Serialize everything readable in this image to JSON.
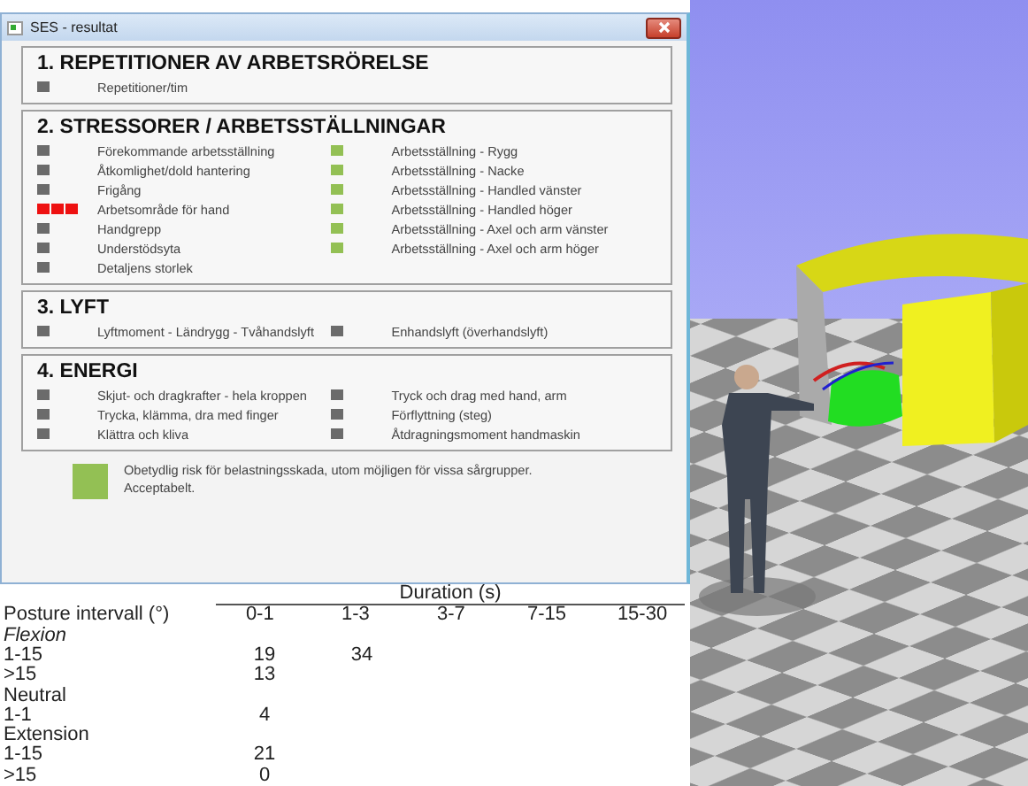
{
  "window": {
    "title": "SES - resultat"
  },
  "sections": [
    {
      "heading": "1. REPETITIONER AV ARBETSRÖRELSE",
      "rows": [
        {
          "left": {
            "label": "Repetitioner/tim",
            "color": "#6b6b6b",
            "kind": "single"
          }
        }
      ]
    },
    {
      "heading": "2. STRESSORER / ARBETSSTÄLLNINGAR",
      "rows": [
        {
          "left": {
            "label": "Förekommande arbetsställning",
            "color": "#6b6b6b",
            "kind": "single"
          },
          "right": {
            "label": "Arbetsställning - Rygg",
            "color": "#93c054",
            "kind": "single"
          }
        },
        {
          "left": {
            "label": "Åtkomlighet/dold hantering",
            "color": "#6b6b6b",
            "kind": "single"
          },
          "right": {
            "label": "Arbetsställning - Nacke",
            "color": "#93c054",
            "kind": "single"
          }
        },
        {
          "left": {
            "label": "Frigång",
            "color": "#6b6b6b",
            "kind": "single"
          },
          "right": {
            "label": "Arbetsställning - Handled vänster",
            "color": "#93c054",
            "kind": "single"
          }
        },
        {
          "left": {
            "label": "Arbetsområde för hand",
            "color": "#ee1111",
            "kind": "triple"
          },
          "right": {
            "label": "Arbetsställning - Handled höger",
            "color": "#93c054",
            "kind": "single"
          }
        },
        {
          "left": {
            "label": "Handgrepp",
            "color": "#6b6b6b",
            "kind": "single"
          },
          "right": {
            "label": "Arbetsställning - Axel och arm vänster",
            "color": "#93c054",
            "kind": "single"
          }
        },
        {
          "left": {
            "label": "Understödsyta",
            "color": "#6b6b6b",
            "kind": "single"
          },
          "right": {
            "label": "Arbetsställning - Axel och arm höger",
            "color": "#93c054",
            "kind": "single"
          }
        },
        {
          "left": {
            "label": "Detaljens storlek",
            "color": "#6b6b6b",
            "kind": "single"
          }
        }
      ]
    },
    {
      "heading": "3. LYFT",
      "rows": [
        {
          "left": {
            "label": "Lyftmoment - Ländrygg - Tvåhandslyft",
            "color": "#6b6b6b",
            "kind": "single"
          },
          "right": {
            "label": "Enhandslyft (överhandslyft)",
            "color": "#6b6b6b",
            "kind": "single"
          }
        }
      ]
    },
    {
      "heading": "4. ENERGI",
      "rows": [
        {
          "left": {
            "label": "Skjut- och dragkrafter - hela kroppen",
            "color": "#6b6b6b",
            "kind": "single"
          },
          "right": {
            "label": "Tryck och drag med hand, arm",
            "color": "#6b6b6b",
            "kind": "single"
          }
        },
        {
          "left": {
            "label": "Trycka, klämma, dra med finger",
            "color": "#6b6b6b",
            "kind": "single"
          },
          "right": {
            "label": "Förflyttning (steg)",
            "color": "#6b6b6b",
            "kind": "single"
          }
        },
        {
          "left": {
            "label": "Klättra och kliva",
            "color": "#6b6b6b",
            "kind": "single"
          },
          "right": {
            "label": "Åtdragningsmoment handmaskin",
            "color": "#6b6b6b",
            "kind": "single"
          }
        }
      ]
    }
  ],
  "legend": {
    "color": "#93c054",
    "lines": [
      "Obetydlig risk för belastningsskada, utom möjligen för vissa sårgrupper.",
      "Acceptabelt."
    ]
  },
  "table": {
    "group_header": "Duration (s)",
    "columns": [
      "Posture intervall (°)",
      "0-1",
      "1-3",
      "3-7",
      "7-15",
      "15-30"
    ],
    "rows": [
      {
        "kind": "group",
        "label": "Flexion",
        "italic": true
      },
      {
        "kind": "data",
        "label": "1-15",
        "values": [
          "19",
          "34"
        ]
      },
      {
        "kind": "data",
        "label": ">15",
        "values": [
          "13"
        ]
      },
      {
        "kind": "group",
        "label": "Neutral",
        "italic": false
      },
      {
        "kind": "data",
        "label": "1-1",
        "values": [
          "4"
        ]
      },
      {
        "kind": "group",
        "label": "Extension",
        "italic": false
      },
      {
        "kind": "data",
        "label": "1-15",
        "values": [
          "21"
        ]
      },
      {
        "kind": "data",
        "label": ">15",
        "values": [
          "0"
        ]
      }
    ]
  }
}
